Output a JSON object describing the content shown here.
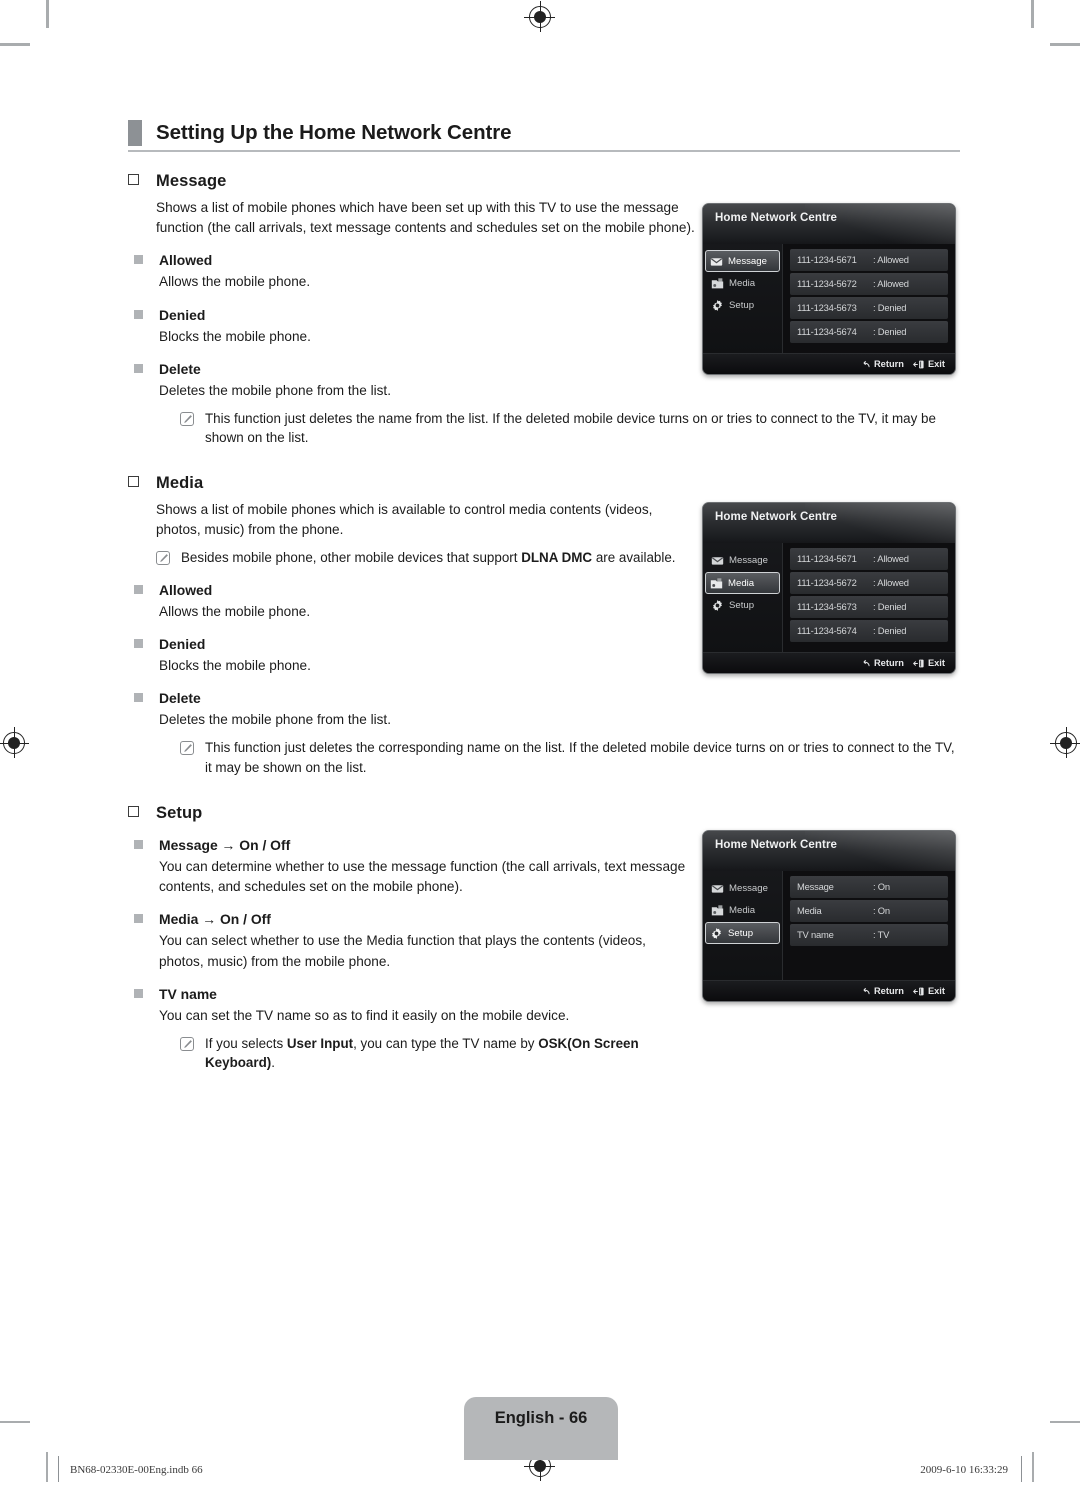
{
  "header": {
    "title": "Setting Up the Home Network Centre"
  },
  "sections": [
    {
      "id": "message",
      "title": "Message",
      "body": "Shows a list of mobile phones which have been set up with this TV to use the message function (the call arrivals, text message contents and schedules set on the mobile phone).",
      "subs": [
        {
          "label": "Allowed",
          "desc": "Allows the mobile phone."
        },
        {
          "label": "Denied",
          "desc": "Blocks the mobile phone."
        },
        {
          "label": "Delete",
          "desc": "Deletes the mobile phone from the list."
        }
      ],
      "note": "This function just deletes the name from the list. If the deleted mobile device turns on or tries to connect to the TV, it may be shown on the list."
    },
    {
      "id": "media",
      "title": "Media",
      "body": "Shows a list of mobile phones which is available to control media contents (videos, photos, music) from the phone.",
      "note_top_pre": "Besides mobile phone, other mobile devices that support ",
      "note_top_bold": "DLNA DMC",
      "note_top_post": " are available.",
      "subs": [
        {
          "label": "Allowed",
          "desc": "Allows the mobile phone."
        },
        {
          "label": "Denied",
          "desc": "Blocks the mobile phone."
        },
        {
          "label": "Delete",
          "desc": "Deletes the mobile phone from the list."
        }
      ],
      "note": "This function just deletes the corresponding name on the list. If the deleted mobile device turns on or tries to connect to the TV, it may be shown on the list."
    },
    {
      "id": "setup",
      "title": "Setup",
      "subs": [
        {
          "label": "Message → On / Off",
          "desc": "You can determine whether to use the message function (the call arrivals, text message contents, and schedules set on the mobile phone)."
        },
        {
          "label": "Media → On / Off",
          "desc": "You can select whether to use the Media function that plays the contents (videos, photos, music) from the mobile phone."
        },
        {
          "label": "TV name",
          "desc": "You can set the TV name so as to find it easily on the mobile device."
        }
      ],
      "note_pre": "If you selects ",
      "note_b1": "User Input",
      "note_mid": ", you can type the TV name by ",
      "note_b2": "OSK(On Screen Keyboard)",
      "note_post": "."
    }
  ],
  "osd": {
    "title": "Home Network Centre",
    "menu": [
      {
        "label": "Message",
        "icon": "envelope-icon"
      },
      {
        "label": "Media",
        "icon": "media-folder-icon"
      },
      {
        "label": "Setup",
        "icon": "gear-icon"
      }
    ],
    "footer": {
      "return": "Return",
      "exit": "Exit"
    },
    "screens": [
      {
        "id": "osd-message",
        "selected": "Message",
        "rows": [
          {
            "name": "111-1234-5671",
            "value": ": Allowed"
          },
          {
            "name": "111-1234-5672",
            "value": ": Allowed"
          },
          {
            "name": "111-1234-5673",
            "value": ": Denied"
          },
          {
            "name": "111-1234-5674",
            "value": ": Denied"
          }
        ]
      },
      {
        "id": "osd-media",
        "selected": "Media",
        "rows": [
          {
            "name": "111-1234-5671",
            "value": ": Allowed"
          },
          {
            "name": "111-1234-5672",
            "value": ": Allowed"
          },
          {
            "name": "111-1234-5673",
            "value": ": Denied"
          },
          {
            "name": "111-1234-5674",
            "value": ": Denied"
          }
        ]
      },
      {
        "id": "osd-setup",
        "selected": "Setup",
        "rows": [
          {
            "name": "Message",
            "value": ": On"
          },
          {
            "name": "Media",
            "value": ": On"
          },
          {
            "name": "TV name",
            "value": ": TV"
          }
        ]
      }
    ]
  },
  "footer": {
    "page_label": "English - 66",
    "file_ref": "BN68-02330E-00Eng.indb   66",
    "timestamp": "2009-6-10   16:33:29"
  }
}
